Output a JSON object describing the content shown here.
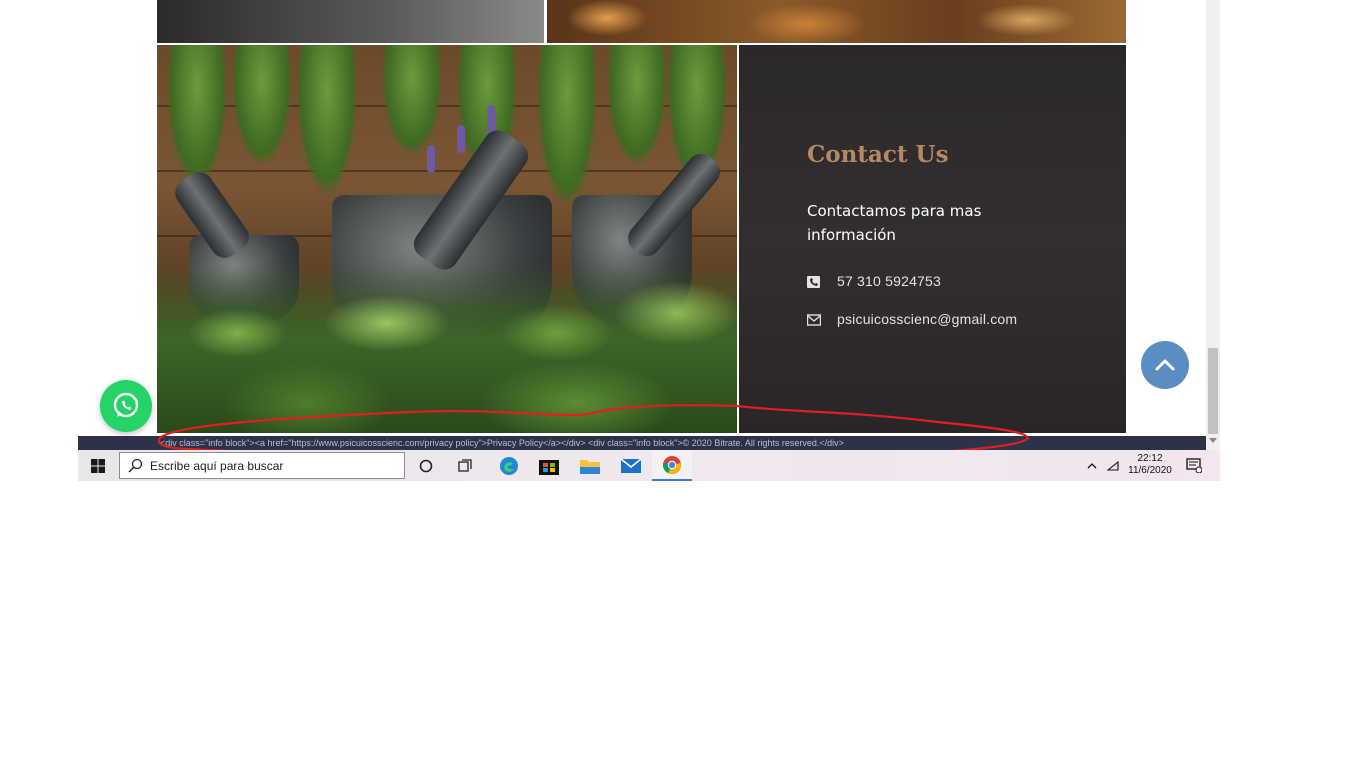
{
  "contact": {
    "title": "Contact Us",
    "subtitle": "Contactamos para mas información",
    "phone": "57 310 5924753",
    "email": "psicuicosscienc@gmail.com"
  },
  "footer": {
    "code_text": "<div class=\"info block\"><a href=\"https://www.psicuicosscienc.com/privacy policy\">Privacy Policy</a></div> <div class=\"info block\">© 2020 Bitrate. All rights reserved.</div>"
  },
  "taskbar": {
    "search_placeholder": "Escribe aquí para buscar",
    "time": "22:12",
    "date": "11/6/2020"
  },
  "icons": [
    "image-herbs-mortar",
    "phone-icon",
    "mail-icon",
    "chevron-up-icon",
    "whatsapp-icon",
    "windows-start-icon",
    "search-icon",
    "cortana-icon",
    "task-view-icon",
    "edge-icon",
    "store-icon",
    "file-explorer-icon",
    "mail-app-icon",
    "chrome-icon",
    "notifications-icon"
  ],
  "colors": {
    "title_accent": "#b28a66",
    "scroll_top_button": "#5a8ec2",
    "whatsapp": "#25d366",
    "footer_strip": "#2c3349",
    "annotation_red": "#e02020"
  }
}
